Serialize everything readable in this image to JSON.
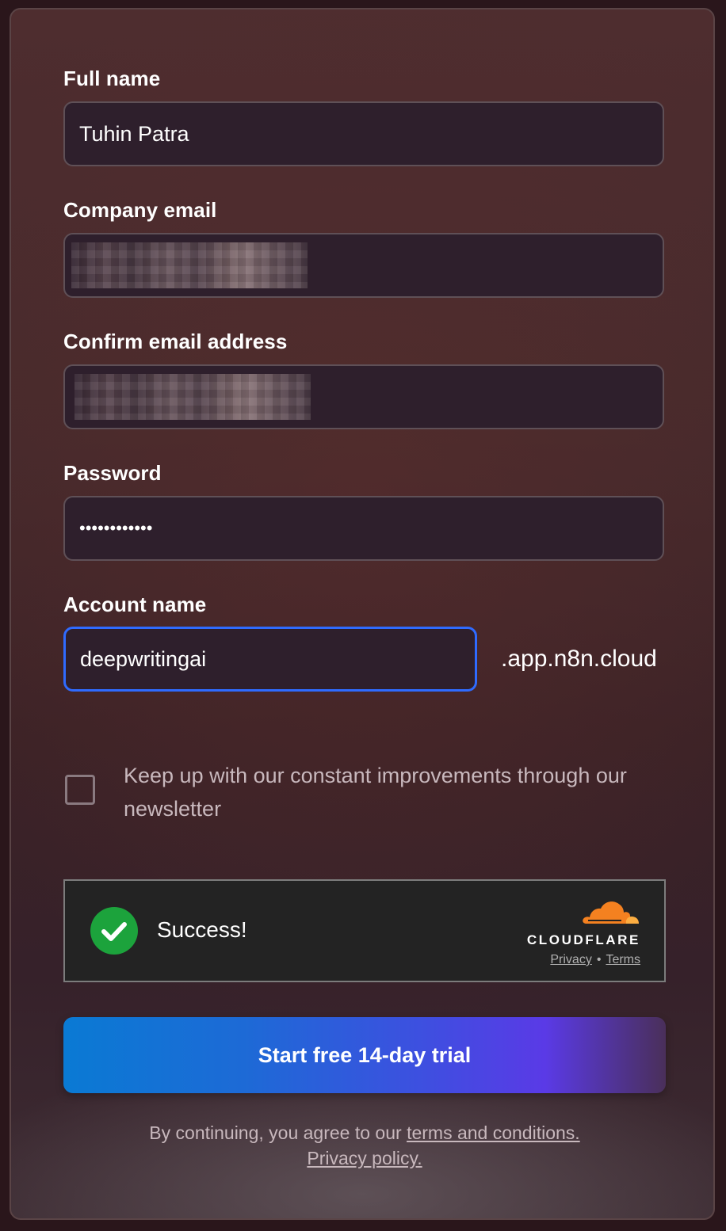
{
  "form": {
    "full_name": {
      "label": "Full name",
      "value": "Tuhin Patra"
    },
    "company_email": {
      "label": "Company email",
      "value": ""
    },
    "confirm_email": {
      "label": "Confirm email address",
      "value": ""
    },
    "password": {
      "label": "Password",
      "value": "••••••••••••"
    },
    "account_name": {
      "label": "Account name",
      "value": "deepwritingai",
      "suffix": ".app.n8n.cloud"
    },
    "newsletter": {
      "label": "Keep up with our constant improvements through our newsletter",
      "checked": false
    }
  },
  "captcha": {
    "status": "Success!",
    "brand": "CLOUDFLARE",
    "privacy_link": "Privacy",
    "separator": "•",
    "terms_link": "Terms",
    "colors": {
      "success": "#1ca33c",
      "brand_cloud": "#f48120"
    }
  },
  "cta": {
    "label": "Start free 14-day trial"
  },
  "legal": {
    "prefix": "By continuing, you agree to our ",
    "terms_link": "terms and conditions.",
    "privacy_link": "Privacy policy."
  }
}
